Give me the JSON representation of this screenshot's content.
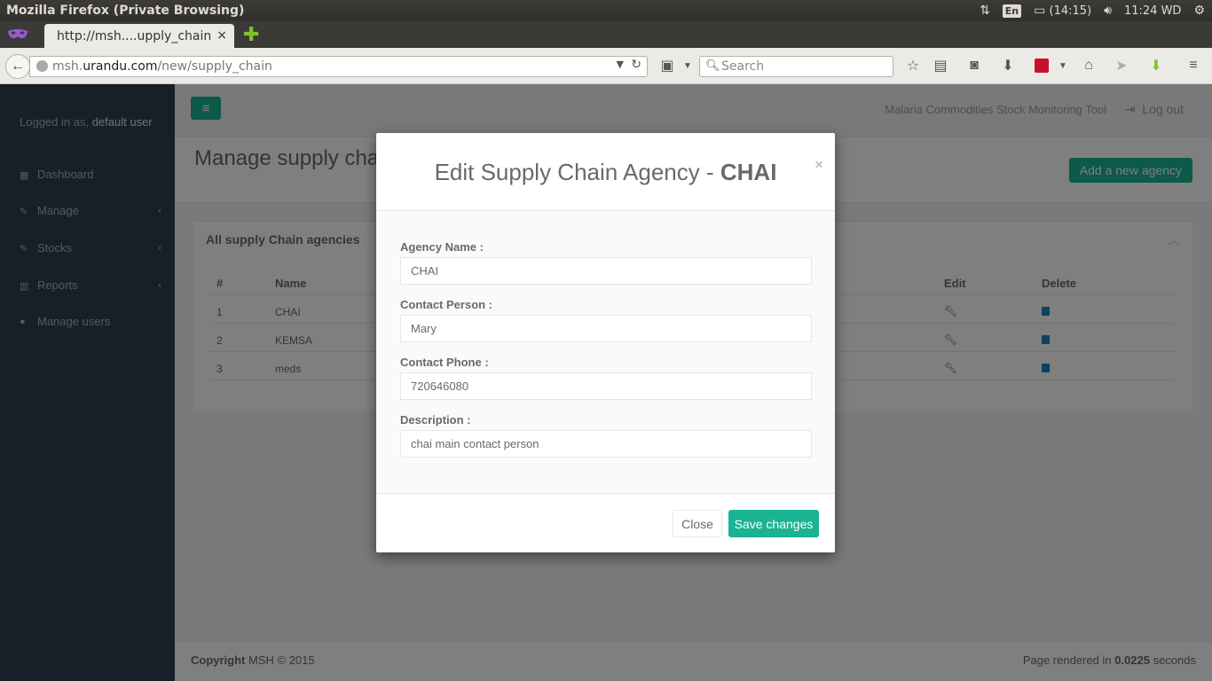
{
  "os": {
    "window_title": "Mozilla Firefox (Private Browsing)",
    "lang": "En",
    "battery": "(14:15)",
    "clock": "11:24 WD"
  },
  "browser": {
    "tab_title": "http://msh....upply_chain",
    "tab_close": "×",
    "new_tab": "✚",
    "url_prefix": "msh.",
    "url_host": "urandu.com",
    "url_path": "/new/supply_chain",
    "search_placeholder": "Search"
  },
  "sidebar": {
    "logged_prefix": "Logged in as,",
    "user": "default user",
    "items": [
      {
        "label": "Dashboard",
        "icon": "grid-icon"
      },
      {
        "label": "Manage",
        "icon": "edit-icon",
        "chevron": "‹"
      },
      {
        "label": "Stocks",
        "icon": "pencil-icon",
        "chevron": "‹"
      },
      {
        "label": "Reports",
        "icon": "chart-icon",
        "chevron": "‹"
      },
      {
        "label": "Manage users",
        "icon": "user-icon"
      }
    ]
  },
  "topnav": {
    "tool_title": "Malaria Commodities Stock Monitoring Tool",
    "logout": "Log out"
  },
  "page": {
    "title": "Manage supply chain",
    "add_button": "Add a new agency",
    "panel_title": "All supply Chain agencies",
    "columns": [
      "#",
      "Name",
      "Edit",
      "Delete"
    ],
    "rows": [
      {
        "num": "1",
        "name": "CHAI"
      },
      {
        "num": "2",
        "name": "KEMSA"
      },
      {
        "num": "3",
        "name": "meds"
      }
    ]
  },
  "footer": {
    "copyright_label": "Copyright",
    "copyright_rest": "MSH © 2015",
    "rendered_prefix": "Page rendered in",
    "rendered_value": "0.0225",
    "rendered_suffix": "seconds"
  },
  "modal": {
    "title_prefix": "Edit Supply Chain Agency -",
    "title_name": "CHAI",
    "close_x": "×",
    "fields": [
      {
        "label": "Agency Name :",
        "value": "CHAI"
      },
      {
        "label": "Contact Person :",
        "value": "Mary"
      },
      {
        "label": "Contact Phone :",
        "value": "720646080"
      },
      {
        "label": "Description :",
        "value": "chai main contact person"
      }
    ],
    "close_button": "Close",
    "save_button": "Save changes"
  },
  "colors": {
    "accent": "#1ab394",
    "sidebar_bg": "#2f4050",
    "delete_icon": "#1c84c6"
  }
}
